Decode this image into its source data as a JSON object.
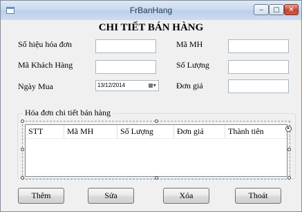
{
  "window": {
    "title": "FrBanHang"
  },
  "form": {
    "heading": "CHI TIẾT BÁN HÀNG",
    "labels": {
      "invoice_no": "Số hiệu hóa đơn",
      "customer_id": "Mã Khách Hàng",
      "purchase_date": "Ngày Mua",
      "product_id": "Mã MH",
      "quantity": "Số Lượng",
      "unit_price": "Đơn giá"
    },
    "fields": {
      "invoice_no": "",
      "customer_id": "",
      "purchase_date": "13/12/2014",
      "product_id": "",
      "quantity": "",
      "unit_price": ""
    }
  },
  "grid": {
    "group_title": "Hóa đơn chi tiết bán hàng",
    "columns": [
      "STT",
      "Mã MH",
      "Số Lượng",
      "Đơn giá",
      "Thành tiên"
    ],
    "rows": []
  },
  "buttons": {
    "add": "Thêm",
    "edit": "Sửa",
    "delete": "Xóa",
    "exit": "Thoát"
  },
  "icons": {
    "app": "form-icon",
    "calendar": "calendar-dropdown-icon"
  },
  "colors": {
    "titlebar": "#c9d9ee",
    "close_button": "#c74532",
    "form_background": "#f0f0f0"
  }
}
